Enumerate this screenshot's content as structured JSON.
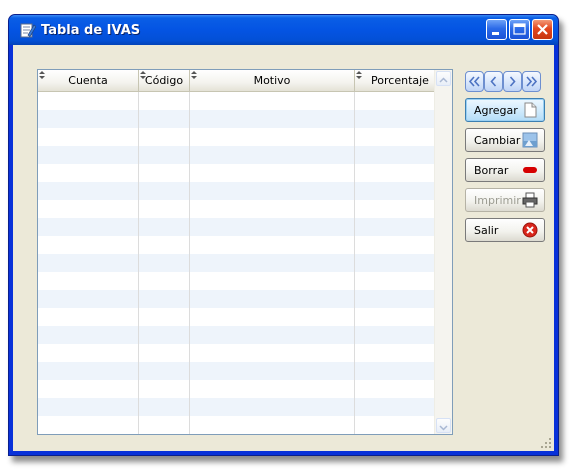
{
  "window": {
    "title": "Tabla de IVAS",
    "icon": "document-edit-icon",
    "controls": [
      "minimize-icon",
      "maximize-icon",
      "close-icon"
    ]
  },
  "table": {
    "columns": [
      "Cuenta",
      "Código",
      "Motivo",
      "Porcentaje"
    ],
    "rows": []
  },
  "navigation": {
    "first": "first-record-icon",
    "previous": "previous-record-icon",
    "next": "next-record-icon",
    "last": "last-record-icon"
  },
  "actions": {
    "add": "Agregar",
    "change": "Cambiar",
    "delete": "Borrar",
    "print": "Imprimir",
    "exit": "Salir"
  },
  "colors": {
    "titlebar": "#0454e3",
    "client": "#ece9d8",
    "row_alt": "#eef4fb"
  }
}
